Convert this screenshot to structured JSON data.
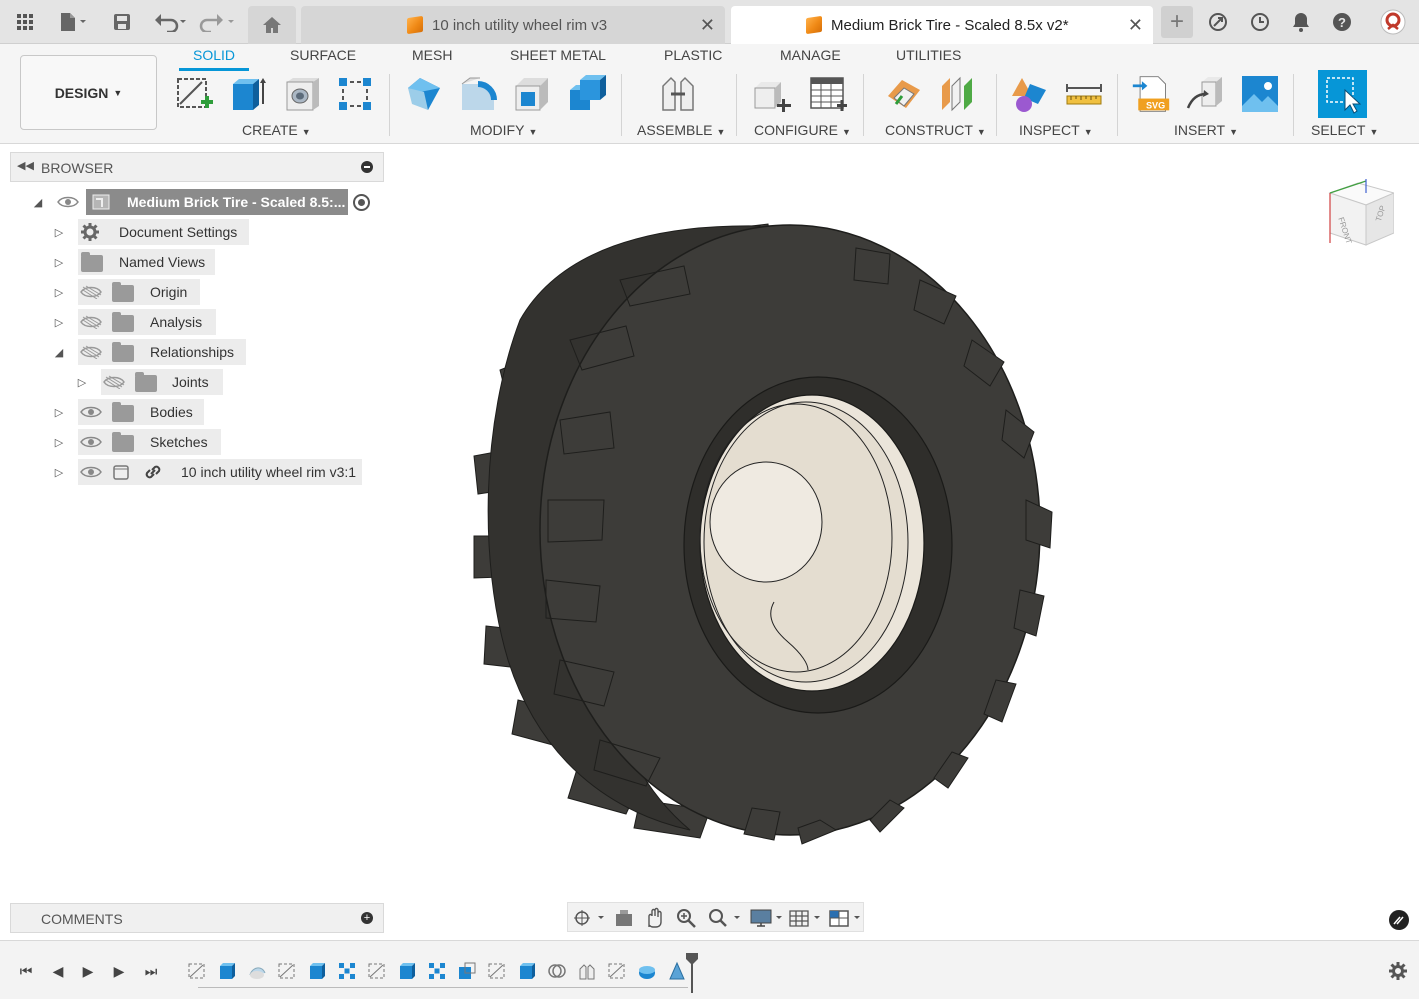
{
  "tabs": [
    {
      "label": "10 inch utility wheel rim v3",
      "active": false
    },
    {
      "label": "Medium Brick Tire - Scaled 8.5x v2*",
      "active": true
    }
  ],
  "toolbar": {
    "workspace_label": "DESIGN",
    "ribbon_tabs": [
      "SOLID",
      "SURFACE",
      "MESH",
      "SHEET METAL",
      "PLASTIC",
      "MANAGE",
      "UTILITIES"
    ],
    "active_ribbon_tab": "SOLID",
    "groups": {
      "create": "CREATE",
      "modify": "MODIFY",
      "assemble": "ASSEMBLE",
      "configure": "CONFIGURE",
      "construct": "CONSTRUCT",
      "inspect": "INSPECT",
      "insert": "INSERT",
      "select": "SELECT"
    },
    "svg_badge": "SVG"
  },
  "browser": {
    "title": "BROWSER",
    "root": "Medium Brick Tire - Scaled 8.5:...",
    "items": [
      {
        "label": "Document Settings",
        "icon": "gear-icon"
      },
      {
        "label": "Named Views",
        "icon": "folder-icon"
      },
      {
        "label": "Origin",
        "icon": "folder-icon",
        "visible": false
      },
      {
        "label": "Analysis",
        "icon": "folder-icon",
        "visible": false
      },
      {
        "label": "Relationships",
        "icon": "folder-icon",
        "visible": false,
        "expanded": true
      },
      {
        "label": "Joints",
        "icon": "folder-icon",
        "visible": false
      },
      {
        "label": "Bodies",
        "icon": "folder-icon",
        "visible": true
      },
      {
        "label": "Sketches",
        "icon": "folder-icon",
        "visible": true
      },
      {
        "label": "10 inch utility wheel rim v3:1",
        "icon": "component-icon",
        "visible": true,
        "linked": true
      }
    ]
  },
  "comments": {
    "title": "COMMENTS"
  },
  "viewcube": {
    "front": "FRONT",
    "top": "TOP"
  },
  "colors": {
    "accent": "#0696d7",
    "tire": "#3d3c39",
    "rim": "#ece6dc",
    "tab_orange": "#f08a16"
  }
}
